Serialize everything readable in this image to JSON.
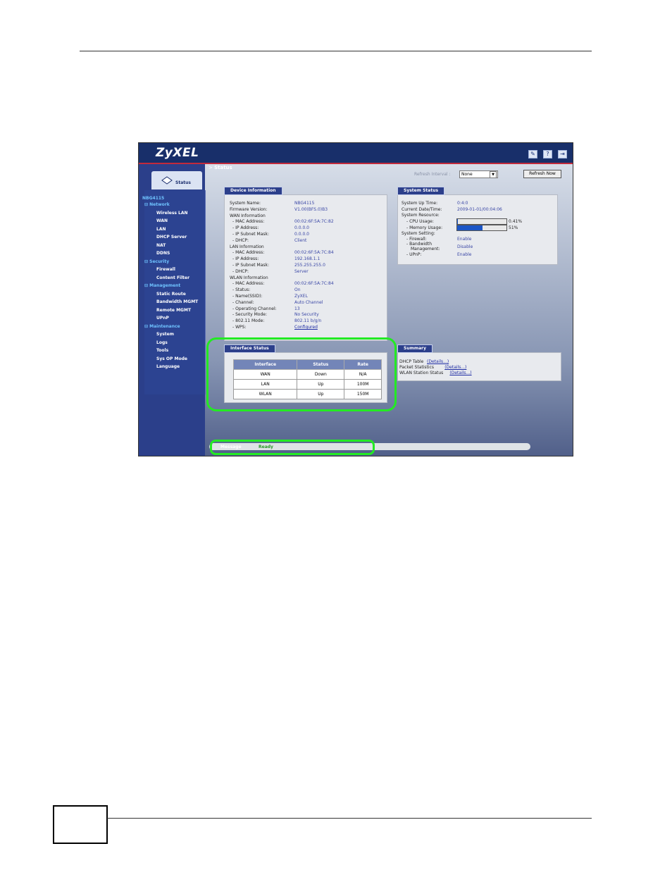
{
  "header": {
    "logo": "ZyXEL",
    "icons": [
      "wizard-icon",
      "help-icon",
      "logout-icon"
    ]
  },
  "sidebar": {
    "tab_label": "Status",
    "device": "NBG4115",
    "groups": [
      {
        "label": "Network",
        "items": [
          "Wireless LAN",
          "WAN",
          "LAN",
          "DHCP Server",
          "NAT",
          "DDNS"
        ]
      },
      {
        "label": "Security",
        "items": [
          "Firewall",
          "Content Filter"
        ]
      },
      {
        "label": "Management",
        "items": [
          "Static Route",
          "Bandwidth MGMT",
          "Remote MGMT",
          "UPnP"
        ]
      },
      {
        "label": "Maintenance",
        "items": [
          "System",
          "Logs",
          "Tools",
          "Sys OP Mode",
          "Language"
        ]
      }
    ]
  },
  "main": {
    "breadcrumb": "Status",
    "refresh_interval_label": "Refresh Interval :",
    "refresh_interval_value": "None",
    "refresh_now_label": "Refresh Now"
  },
  "device_information": {
    "title": "Device Information",
    "rows": [
      {
        "label": "System Name:",
        "value": "NBG4115"
      },
      {
        "label": "Firmware Version:",
        "value": "V1.00(BFS.0)B3"
      },
      {
        "label": "WAN Information",
        "value": ""
      },
      {
        "label": "- MAC Address:",
        "value": "00:02:6F:5A:7C:82"
      },
      {
        "label": "- IP Address:",
        "value": "0.0.0.0"
      },
      {
        "label": "- IP Subnet Mask:",
        "value": "0.0.0.0"
      },
      {
        "label": "- DHCP:",
        "value": "Client"
      },
      {
        "label": "LAN Information",
        "value": ""
      },
      {
        "label": "- MAC Address:",
        "value": "00:02:6F:5A:7C:84"
      },
      {
        "label": "- IP Address:",
        "value": "192.168.1.1"
      },
      {
        "label": "- IP Subnet Mask:",
        "value": "255.255.255.0"
      },
      {
        "label": "- DHCP:",
        "value": "Server"
      },
      {
        "label": "WLAN Information",
        "value": ""
      },
      {
        "label": "- MAC Address:",
        "value": "00:02:6F:5A:7C:84"
      },
      {
        "label": "- Status:",
        "value": "On"
      },
      {
        "label": "- Name(SSID):",
        "value": "ZyXEL"
      },
      {
        "label": "- Channel:",
        "value": "Auto Channel"
      },
      {
        "label": "- Operating Channel:",
        "value": "13"
      },
      {
        "label": "- Security Mode:",
        "value": "No Security"
      },
      {
        "label": "- 802.11 Mode:",
        "value": "802.11 b/g/n"
      },
      {
        "label": "- WPS:",
        "value": "Configured"
      }
    ]
  },
  "system_status": {
    "title": "System Status",
    "uptime_label": "System Up Time:",
    "uptime_value": "0:4:0",
    "datetime_label": "Current Date/Time:",
    "datetime_value": "2009-01-01/00:04:06",
    "resource_label": "System Resource:",
    "cpu_label": "- CPU Usage:",
    "cpu_value": "0.41%",
    "cpu_fraction": 0.0041,
    "memory_label": "- Memory Usage:",
    "memory_value": "51%",
    "memory_fraction": 0.51,
    "setting_label": "System Setting:",
    "firewall_label": "- Firewall:",
    "firewall_value": "Enable",
    "bandwidth_label_1": "- Bandwidth",
    "bandwidth_label_2": "Management:",
    "bandwidth_value": "Disable",
    "upnp_label": "- UPnP:",
    "upnp_value": "Enable"
  },
  "interface_status": {
    "title": "Interface Status",
    "headers": [
      "Interface",
      "Status",
      "Rate"
    ],
    "rows": [
      [
        "WAN",
        "Down",
        "N/A"
      ],
      [
        "LAN",
        "Up",
        "100M"
      ],
      [
        "WLAN",
        "Up",
        "150M"
      ]
    ]
  },
  "summary": {
    "title": "Summary",
    "rows": [
      {
        "label": "DHCP Table",
        "link": "(Details...)"
      },
      {
        "label": "Packet Statistics",
        "link": "(Details...)"
      },
      {
        "label": "WLAN Station Status",
        "link": "(Details...)"
      }
    ]
  },
  "message_bar": {
    "label": "Message",
    "text": "Ready"
  },
  "colors": {
    "highlight": "#23ea23",
    "header_bg": "#182f6a",
    "accent_red": "#c12a3b"
  }
}
